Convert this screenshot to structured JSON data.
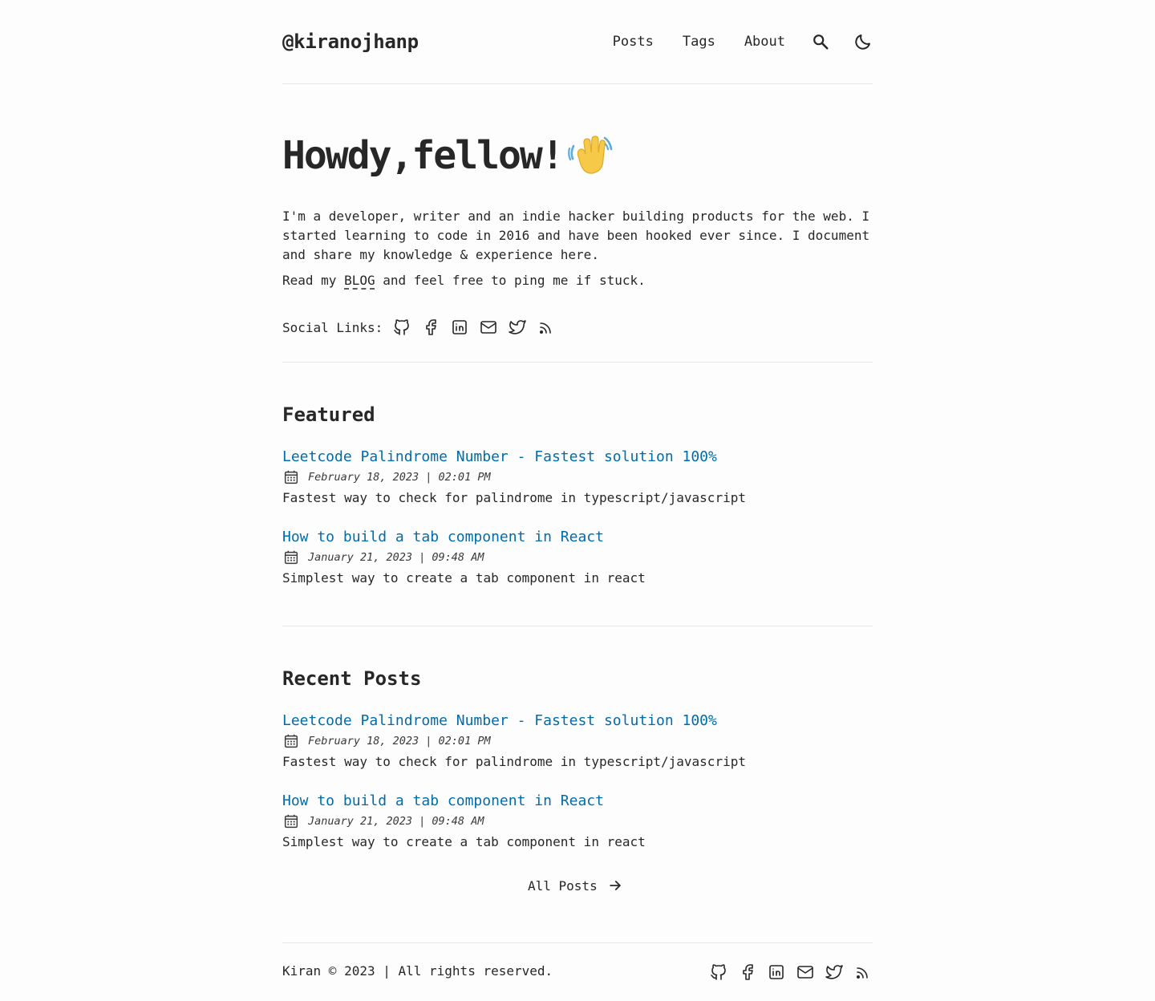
{
  "header": {
    "logo": "@kiranojhanp",
    "nav": [
      "Posts",
      "Tags",
      "About"
    ]
  },
  "hero": {
    "title": "Howdy,fellow!",
    "intro": "I'm a developer, writer and an indie hacker building products for the web. I started learning to code in 2016 and have been hooked ever since. I document and share my knowledge & experience here.",
    "read_prefix": "Read my ",
    "blog_link": "BLOG",
    "read_suffix": " and feel free to ping me if stuck.",
    "social_label": "Social Links:"
  },
  "featured": {
    "title": "Featured",
    "posts": [
      {
        "title": "Leetcode Palindrome Number - Fastest solution 100%",
        "date": "February 18, 2023 | 02:01 PM",
        "desc": "Fastest way to check for palindrome in typescript/javascript"
      },
      {
        "title": "How to build a tab component in React",
        "date": "January 21, 2023 | 09:48 AM",
        "desc": "Simplest way to create a tab component in react"
      }
    ]
  },
  "recent": {
    "title": "Recent Posts",
    "posts": [
      {
        "title": "Leetcode Palindrome Number - Fastest solution 100%",
        "date": "February 18, 2023 | 02:01 PM",
        "desc": "Fastest way to check for palindrome in typescript/javascript"
      },
      {
        "title": "How to build a tab component in React",
        "date": "January 21, 2023 | 09:48 AM",
        "desc": "Simplest way to create a tab component in react"
      }
    ],
    "all_posts": "All Posts"
  },
  "footer": {
    "copyright": "Kiran © 2023 | All rights reserved."
  },
  "social_icons": [
    "github-icon",
    "facebook-icon",
    "linkedin-icon",
    "mail-icon",
    "twitter-icon",
    "rss-icon"
  ],
  "colors": {
    "accent": "#006cac",
    "text": "#282728",
    "background": "#fdfdfd",
    "border": "#e6e6e6"
  }
}
